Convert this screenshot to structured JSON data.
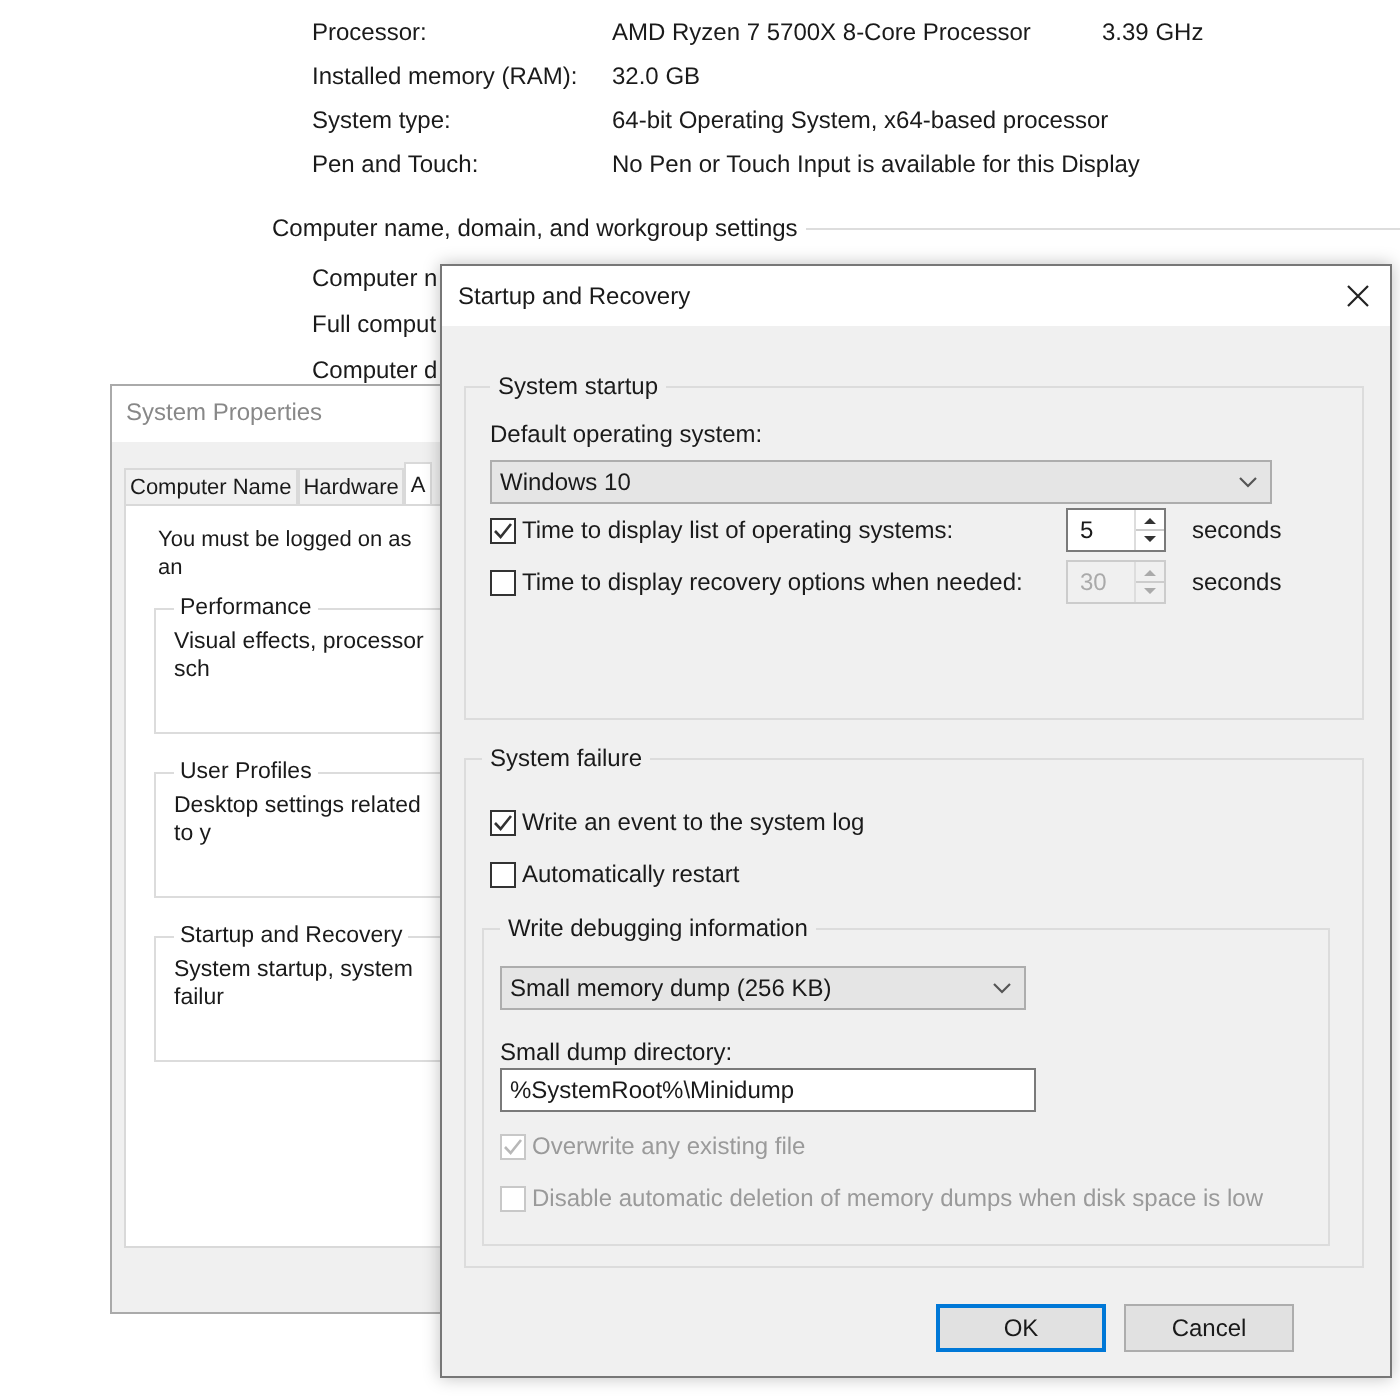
{
  "system_info": {
    "rows": [
      {
        "label": "Processor:",
        "value": "AMD Ryzen 7 5700X 8-Core Processor",
        "extra": "3.39 GHz"
      },
      {
        "label": "Installed memory (RAM):",
        "value": "32.0 GB"
      },
      {
        "label": "System type:",
        "value": "64-bit Operating System, x64-based processor"
      },
      {
        "label": "Pen and Touch:",
        "value": "No Pen or Touch Input is available for this Display"
      }
    ],
    "section_heading": "Computer name, domain, and workgroup settings",
    "section_rows": [
      "Computer n",
      "Full comput",
      "Computer d"
    ]
  },
  "system_properties": {
    "title": "System Properties",
    "tabs": [
      {
        "label": "Computer Name",
        "selected": false
      },
      {
        "label": "Hardware",
        "selected": false
      },
      {
        "label": "A",
        "selected": true
      }
    ],
    "notice": "You must be logged on as an",
    "groups": [
      {
        "title": "Performance",
        "description": "Visual effects, processor sch"
      },
      {
        "title": "User Profiles",
        "description": "Desktop settings related to y"
      },
      {
        "title": "Startup and Recovery",
        "description": "System startup, system failur"
      }
    ]
  },
  "dialog": {
    "title": "Startup and Recovery",
    "startup": {
      "title": "System startup",
      "default_os_label": "Default operating system:",
      "default_os": "Windows 10",
      "timeouts": [
        {
          "label": "Time to display list of operating systems:",
          "checked": true,
          "value": "5",
          "unit": "seconds"
        },
        {
          "label": "Time to display recovery options when needed:",
          "checked": false,
          "value": "30",
          "unit": "seconds"
        }
      ]
    },
    "failure": {
      "title": "System failure",
      "options": [
        {
          "label": "Write an event to the system log",
          "checked": true
        },
        {
          "label": "Automatically restart",
          "checked": false
        }
      ],
      "debug": {
        "title": "Write debugging information",
        "dump_type": "Small memory dump (256 KB)",
        "directory_label": "Small dump directory:",
        "directory": "%SystemRoot%\\Minidump",
        "options": [
          {
            "label": "Overwrite any existing file",
            "checked": true,
            "disabled": true
          },
          {
            "label": "Disable automatic deletion of memory dumps when disk space is low",
            "checked": false,
            "disabled": true
          }
        ]
      }
    },
    "buttons": [
      {
        "label": "OK",
        "default": true
      },
      {
        "label": "Cancel",
        "default": false
      }
    ]
  }
}
